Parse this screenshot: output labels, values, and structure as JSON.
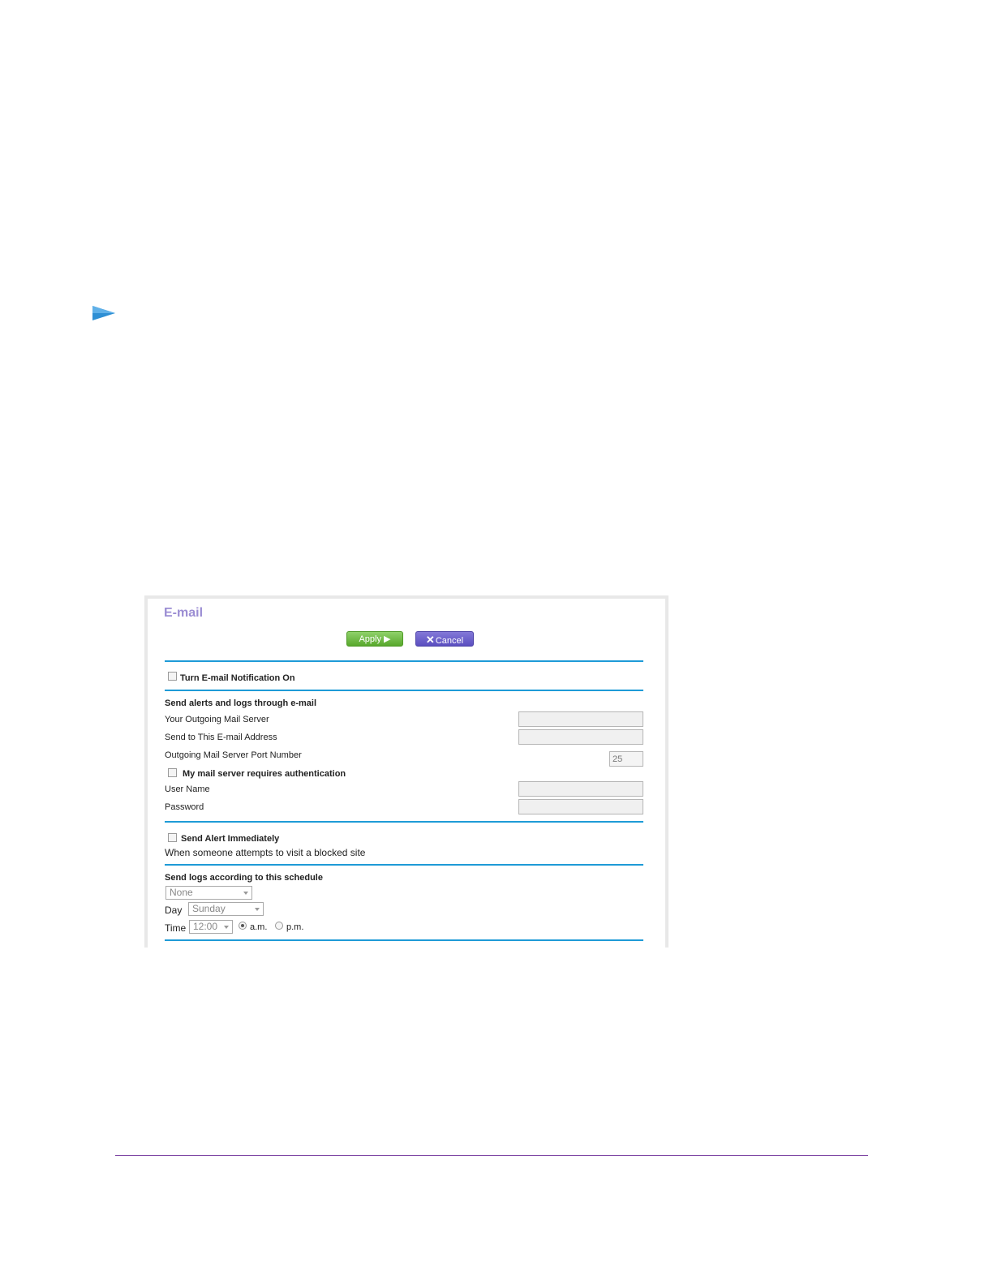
{
  "panel": {
    "title": "E-mail",
    "apply_label": "Apply ▶",
    "cancel_icon": "✕",
    "cancel_label": "Cancel"
  },
  "notification": {
    "label": "Turn E-mail Notification On",
    "checked": false
  },
  "alerts": {
    "heading": "Send alerts and logs through e-mail",
    "outgoing_server_label": "Your Outgoing Mail Server",
    "outgoing_server_value": "",
    "send_to_label": "Send to This E-mail Address",
    "send_to_value": "",
    "port_label": "Outgoing Mail Server Port Number",
    "port_value": "25",
    "auth_label": "My mail server requires authentication",
    "username_label": "User Name",
    "username_value": "",
    "password_label": "Password",
    "password_value": ""
  },
  "alert_immediately": {
    "label": "Send Alert Immediately",
    "description": "When someone attempts to visit a blocked site"
  },
  "schedule": {
    "heading": "Send logs according to this schedule",
    "frequency_value": "None",
    "day_label": "Day",
    "day_value": "Sunday",
    "time_label": "Time",
    "time_value": "12:00",
    "am_label": "a.m.",
    "pm_label": "p.m.",
    "selected_period": "a.m."
  },
  "colors": {
    "title": "#9b8dd3",
    "rule": "#1e9bd7",
    "apply": "#6cbb3c",
    "cancel": "#6a5fcc",
    "arrow": "#2e8fd4",
    "footer_line": "#7a3fa0"
  }
}
